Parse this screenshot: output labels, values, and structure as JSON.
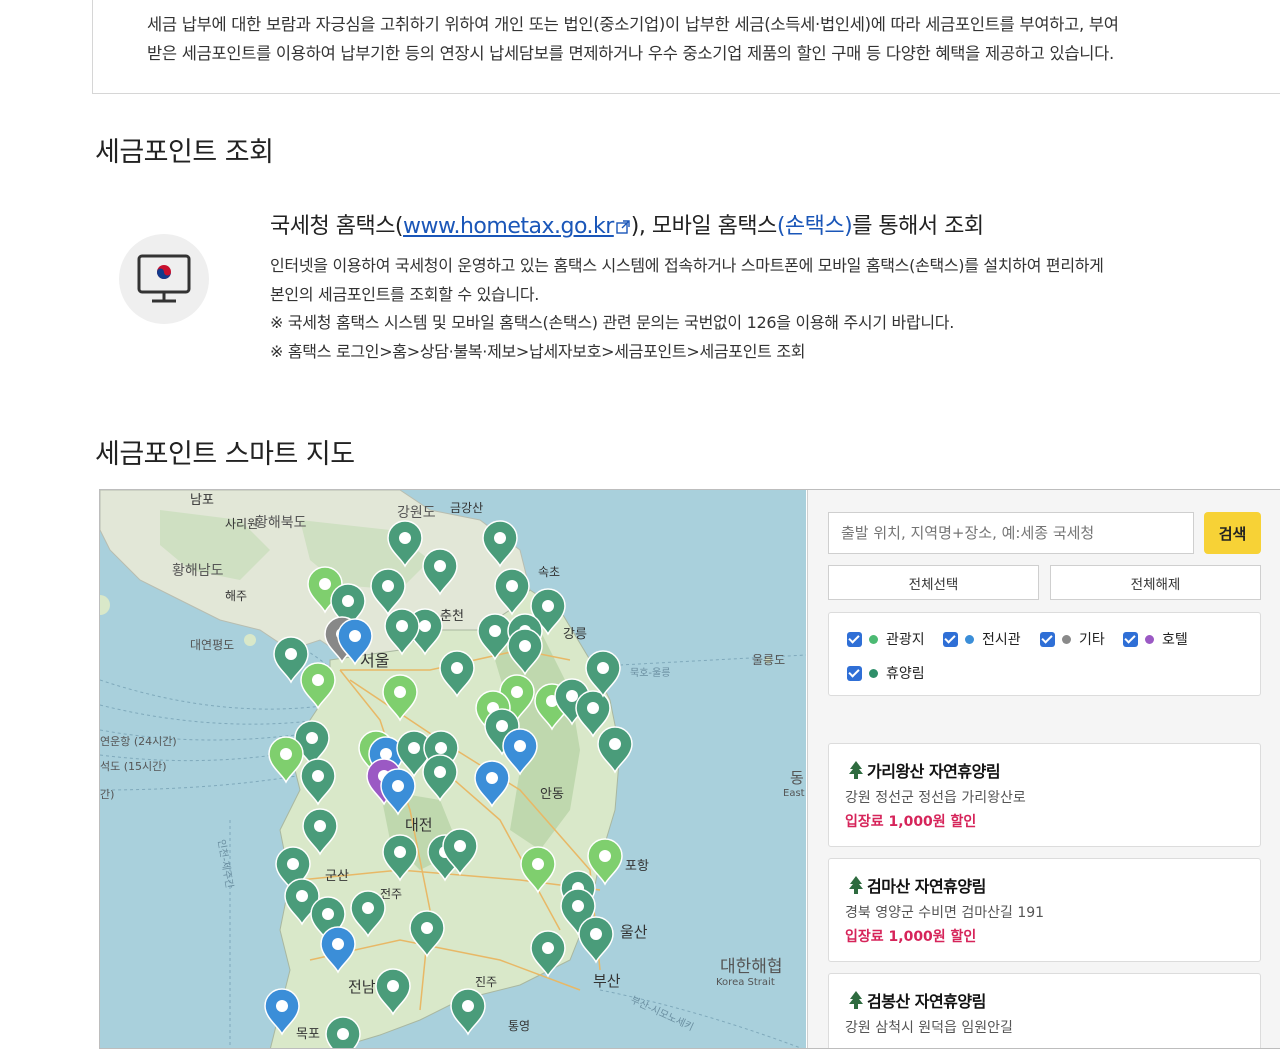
{
  "intro": {
    "line1": "세금 납부에 대한 보람과 자긍심을 고취하기 위하여 개인 또는 법인(중소기업)이 납부한 세금(소득세·법인세)에 따라 세금포인트를 부여하고, 부여",
    "line2": "받은 세금포인트를 이용하여 납부기한 등의 연장시 납세담보를 면제하거나 우수 중소기업 제품의 할인 구매 등 다양한 혜택을 제공하고 있습니다."
  },
  "lookup": {
    "title": "세금포인트 조회",
    "head_prefix": "국세청 홈택스(",
    "head_link": "www.hometax.go.kr",
    "head_middle": "), 모바일 홈택스",
    "head_app": "(손택스)",
    "head_suffix": "를 통해서 조회",
    "desc1": "인터넷을 이용하여 국세청이 운영하고 있는 홈택스 시스템에 접속하거나 스마트폰에 모바일 홈택스(손택스)를 설치하여 편리하게",
    "desc2": "본인의 세금포인트를 조회할 수 있습니다.",
    "note1": "※ 국세청 홈택스 시스템 및 모바일 홈택스(손택스) 관련 문의는 국번없이 126을 이용해 주시기 바랍니다.",
    "note2": "※ 홈택스 로그인>홈>상담·불복·제보>납세자보호>세금포인트>세금포인트 조회",
    "icon": "monitor-icon"
  },
  "smartmap": {
    "title": "세금포인트 스마트 지도",
    "labels": {
      "nampo": "남포",
      "sariwon": "사리원",
      "hwanghaebukdo": "황해북도",
      "hwanghaenamdo": "황해남도",
      "haeju": "해주",
      "gangwondo": "강원도",
      "geumgangsan": "금강산",
      "sokcho": "속초",
      "chuncheon": "춘천",
      "gangneung": "강릉",
      "seoul": "서울",
      "ulleungdo": "울릉도",
      "andong": "안동",
      "daejeon": "대전",
      "gunsan": "군산",
      "jeonju": "전주",
      "pohang": "포항",
      "ulsan": "울산",
      "busan": "부산",
      "jinju": "진주",
      "jeonnam": "전남",
      "mokpo": "목포",
      "tongyeong": "통영",
      "daehanhaehyeop": "대한해협",
      "korea_strait": "Korea Strait",
      "dong": "동",
      "east": "East",
      "yeonpyeongdo": "대연평도",
      "ferry1": "연운항 (24시간)",
      "ferry2": "석도 (15시간)",
      "ferry3": "간)",
      "route": "부산-시모노세키",
      "northsea": "묵호-울릉",
      "jeju_route": "인천-제주간"
    },
    "search_placeholder": "출발 위치, 지역명+장소, 예:세종 국세청",
    "search_button": "검색",
    "select_all": "전체선택",
    "deselect_all": "전체해제",
    "filters": [
      {
        "label": "관광지",
        "color": "#4cba73"
      },
      {
        "label": "전시관",
        "color": "#3b8ed8"
      },
      {
        "label": "기타",
        "color": "#8a8a8a"
      },
      {
        "label": "호텔",
        "color": "#9b59c4"
      },
      {
        "label": "휴양림",
        "color": "#2f8f6a"
      }
    ],
    "results": [
      {
        "name": "가리왕산 자연휴양림",
        "address": "강원 정선군 정선읍 가리왕산로",
        "benefit": "입장료 1,000원 할인"
      },
      {
        "name": "검마산 자연휴양림",
        "address": "경북 영양군 수비면 검마산길 191",
        "benefit": "입장료 1,000원 할인"
      },
      {
        "name": "검봉산 자연휴양림",
        "address": "강원 삼척시 원덕읍 임원안길",
        "benefit": ""
      }
    ]
  }
}
